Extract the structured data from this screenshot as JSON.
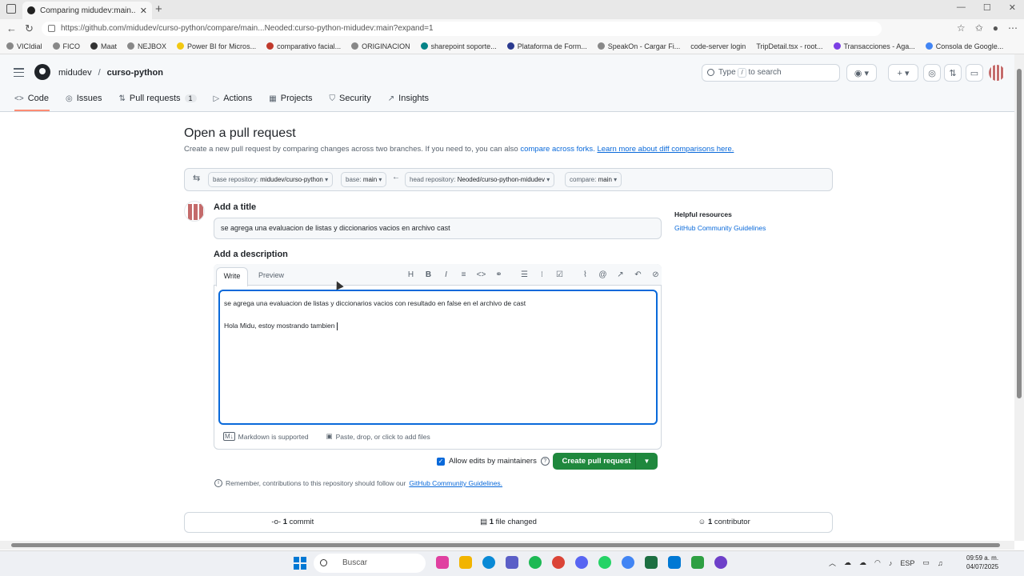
{
  "browser": {
    "tab_title": "Comparing midudev:main...Neod",
    "url": "https://github.com/midudev/curso-python/compare/main...Neoded:curso-python-midudev:main?expand=1",
    "bookmarks": [
      "VICIdial",
      "FICO",
      "Maat",
      "NEJBOX",
      "Power BI for Micros...",
      "comparativo facial...",
      "ORIGINACION",
      "sharepoint soporte...",
      "Plataforma de Form...",
      "SpeakOn - Cargar Fi...",
      "code-server login",
      "TripDetail.tsx - root...",
      "Transacciones - Aga...",
      "Consola de Google..."
    ]
  },
  "header": {
    "owner": "midudev",
    "separator": "/",
    "repo": "curso-python",
    "search_prefix": "Type",
    "search_key": "/",
    "search_suffix": "to search"
  },
  "repo_nav": {
    "code": "Code",
    "issues": "Issues",
    "pull_requests": "Pull requests",
    "pull_requests_count": "1",
    "actions": "Actions",
    "projects": "Projects",
    "security": "Security",
    "insights": "Insights"
  },
  "main": {
    "title": "Open a pull request",
    "subtitle": "Create a new pull request by comparing changes across two branches. If you need to, you can also",
    "compare_forks": "compare across forks.",
    "learn_more": "Learn more about diff comparisons here.",
    "base_repo_label": "base repository:",
    "base_repo_value": "midudev/curso-python",
    "base_label": "base:",
    "base_value": "main",
    "head_repo_label": "head repository:",
    "head_repo_value": "Neoded/curso-python-midudev",
    "compare_label": "compare:",
    "compare_value": "main",
    "add_title_label": "Add a title",
    "title_value": "se agrega una evaluacion de listas y diccionarios vacios en archivo cast",
    "add_description_label": "Add a description",
    "tab_write": "Write",
    "tab_preview": "Preview",
    "description_line1": "se agrega una evaluacion de listas y diccionarios vacios con resultado en false en el archivo de cast",
    "description_line2": "Hola Midu, estoy mostrando tambien",
    "markdown_supported": "Markdown is supported",
    "paste_files": "Paste, drop, or click to add files",
    "allow_edits": "Allow edits by maintainers",
    "create_button": "Create pull request",
    "remember_text": "Remember, contributions to this repository should follow our",
    "community_guidelines": "GitHub Community Guidelines.",
    "commits_count": "1",
    "commits_label": "commit",
    "files_count": "1",
    "files_label": "file changed",
    "contributors_count": "1",
    "contributors_label": "contributor"
  },
  "sidebar": {
    "helpful_title": "Helpful resources",
    "guidelines_link": "GitHub Community Guidelines"
  },
  "taskbar": {
    "search_placeholder": "Buscar",
    "language": "ESP",
    "time": "09:59 a. m.",
    "date": "04/07/2025"
  },
  "colors": {
    "accent": "#0969da",
    "create_button": "#1f883d",
    "nav_underline": "#fd8c73"
  }
}
